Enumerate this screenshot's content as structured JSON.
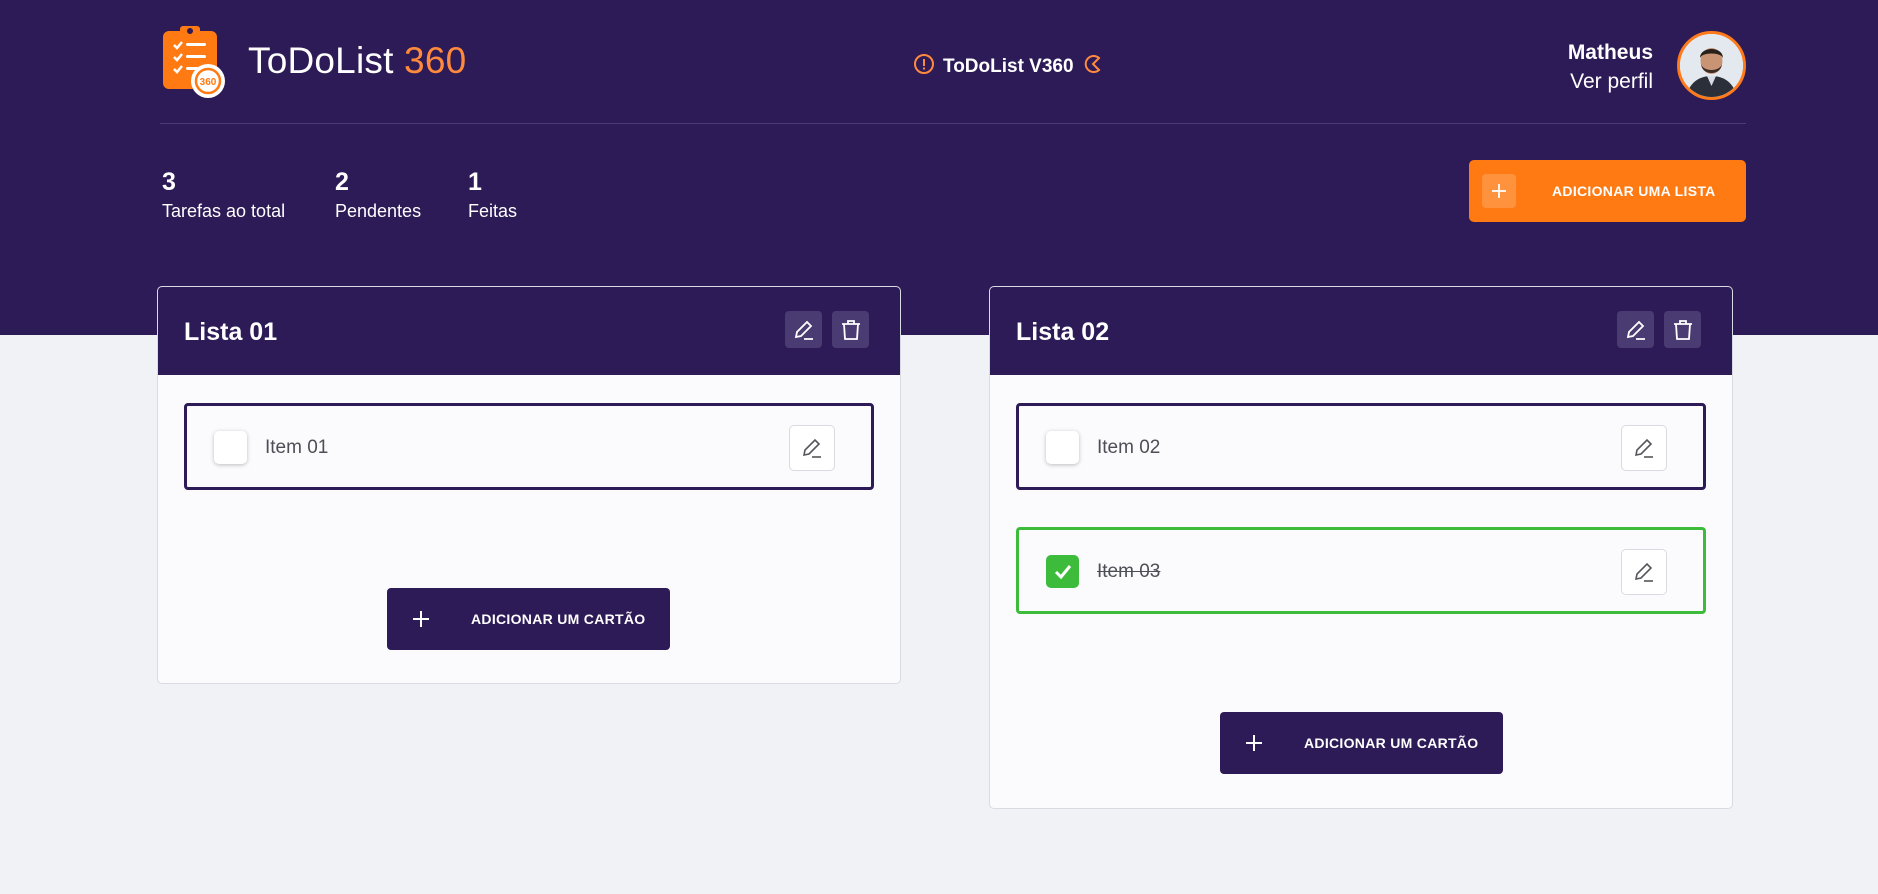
{
  "header": {
    "app_name": "ToDoList",
    "app_name_accent": "360",
    "version_label": "ToDoList V360",
    "user_name": "Matheus",
    "profile_link": "Ver perfil"
  },
  "stats": [
    {
      "value": "3",
      "label": "Tarefas ao total"
    },
    {
      "value": "2",
      "label": "Pendentes"
    },
    {
      "value": "1",
      "label": "Feitas"
    }
  ],
  "actions": {
    "add_list_label": "ADICIONAR UMA LISTA",
    "add_card_label": "ADICIONAR UM CARTÃO"
  },
  "lists": [
    {
      "title": "Lista 01",
      "items": [
        {
          "text": "Item 01",
          "done": false
        }
      ]
    },
    {
      "title": "Lista 02",
      "items": [
        {
          "text": "Item 02",
          "done": false
        },
        {
          "text": "Item 03",
          "done": true
        }
      ]
    }
  ],
  "colors": {
    "primary": "#2d1b57",
    "accent": "#ff7a12",
    "done": "#3dbb3b",
    "background": "#f1f2f5"
  },
  "icons": {
    "logo": "clipboard-checklist-icon",
    "version": "alert-circle-icon",
    "edit": "pencil-icon",
    "delete": "trash-icon",
    "add": "plus-icon",
    "check": "checkmark-icon"
  }
}
